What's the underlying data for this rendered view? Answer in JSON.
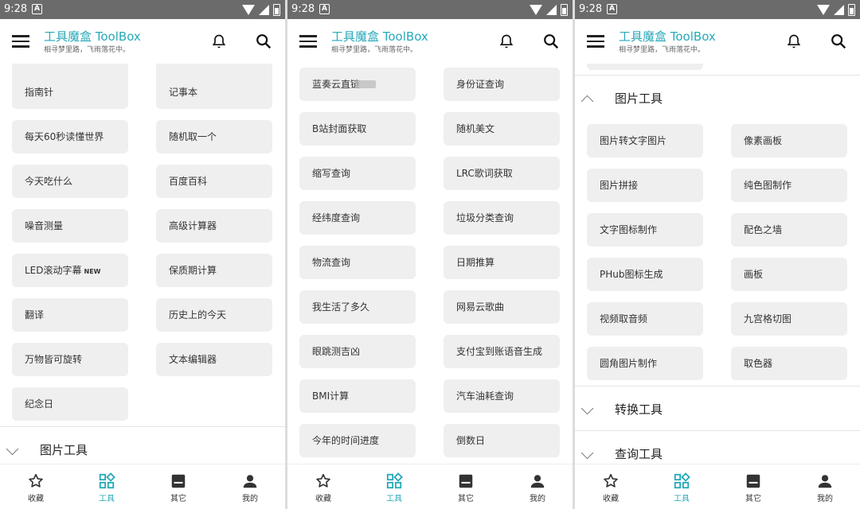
{
  "status": {
    "time": "9:28",
    "notif_letter": "A"
  },
  "app": {
    "title": "工具魔盒 ToolBox",
    "subtitle": "相寻梦里路，飞雨落花中。"
  },
  "nav": [
    "收藏",
    "工具",
    "其它",
    "我的"
  ],
  "colors": {
    "accent": "#27a9b8",
    "button_bg": "#efefef",
    "status_bar": "#6b6b6b"
  },
  "icons": [
    "menu-icon",
    "bell-icon",
    "search-icon",
    "star-icon",
    "grid-icon",
    "inbox-icon",
    "person-icon",
    "chevron-down-icon",
    "chevron-up-icon"
  ],
  "screen1": {
    "tools": [
      "指南针",
      "记事本",
      "每天60秒读懂世界",
      "随机取一个",
      "今天吃什么",
      "百度百科",
      "噪音测量",
      "高级计算器",
      "LED滚动字幕",
      "保质期计算",
      "翻译",
      "历史上的今天",
      "万物皆可旋转",
      "文本编辑器",
      "纪念日"
    ],
    "new_badge": "NEW",
    "section": "图片工具"
  },
  "screen2": {
    "tools": [
      "蓝奏云直链",
      "身份证查询",
      "B站封面获取",
      "随机美文",
      "缩写查询",
      "LRC歌词获取",
      "经纬度查询",
      "垃圾分类查询",
      "物流查询",
      "日期推算",
      "我生活了多久",
      "网易云歌曲",
      "眼跳测吉凶",
      "支付宝到账语音生成",
      "BMI计算",
      "汽车油耗查询",
      "今年的时间进度",
      "倒数日"
    ]
  },
  "screen3": {
    "section_open": "图片工具",
    "tools": [
      "图片转文字图片",
      "像素画板",
      "图片拼接",
      "纯色图制作",
      "文字图标制作",
      "配色之墙",
      "PHub图标生成",
      "画板",
      "视频取音频",
      "九宫格切图",
      "圆角图片制作",
      "取色器"
    ],
    "section_closed_1": "转换工具",
    "section_closed_2": "查询工具"
  }
}
